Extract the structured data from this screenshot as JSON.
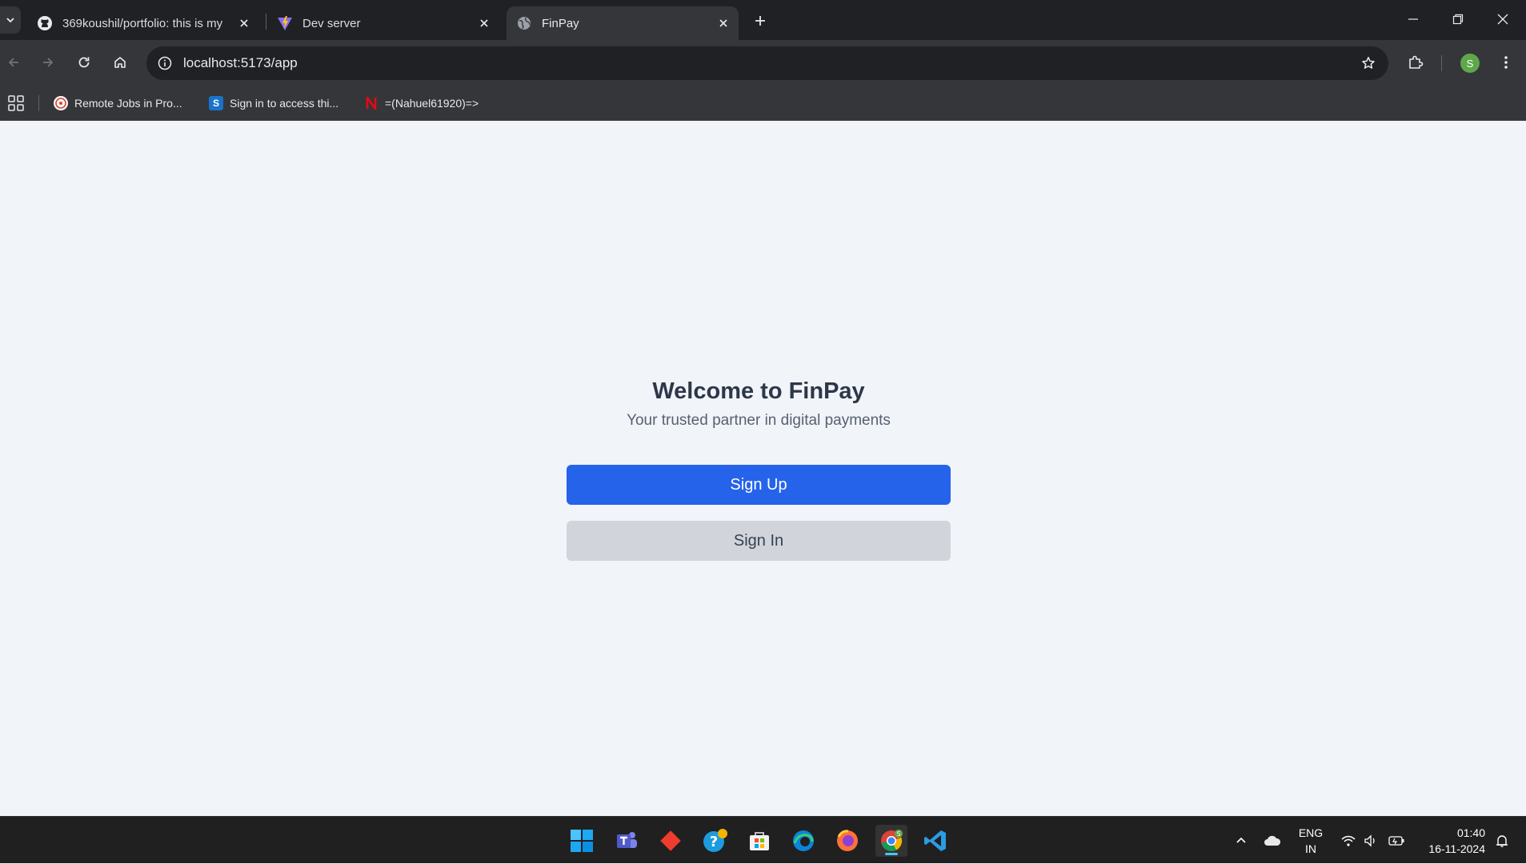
{
  "browser": {
    "tabs": [
      {
        "title": "369koushil/portfolio: this is my",
        "favicon": "github-icon",
        "active": false
      },
      {
        "title": "Dev server",
        "favicon": "vite-icon",
        "active": false
      },
      {
        "title": "FinPay",
        "favicon": "globe-icon",
        "active": true
      }
    ],
    "url": "localhost:5173/app",
    "profile_initial": "S",
    "bookmarks": [
      {
        "label": "Remote Jobs in Pro...",
        "icon": "remote-jobs-icon"
      },
      {
        "label": "Sign in to access thi...",
        "icon": "s-brand-icon"
      },
      {
        "label": "=(Nahuel61920)=>",
        "icon": "n-logo-icon"
      }
    ]
  },
  "page": {
    "title": "Welcome to FinPay",
    "subtitle": "Your trusted partner in digital payments",
    "signup_label": "Sign Up",
    "signin_label": "Sign In"
  },
  "colors": {
    "primary": "#2563eb",
    "secondary": "#d1d5db",
    "page_bg": "#f1f4f9"
  },
  "taskbar": {
    "apps": [
      "windows-start-icon",
      "teams-icon",
      "git-icon",
      "help-icon",
      "store-icon",
      "edge-icon",
      "firefox-icon",
      "chrome-icon",
      "vscode-icon"
    ],
    "language_top": "ENG",
    "language_bottom": "IN",
    "time": "01:40",
    "date": "16-11-2024"
  }
}
